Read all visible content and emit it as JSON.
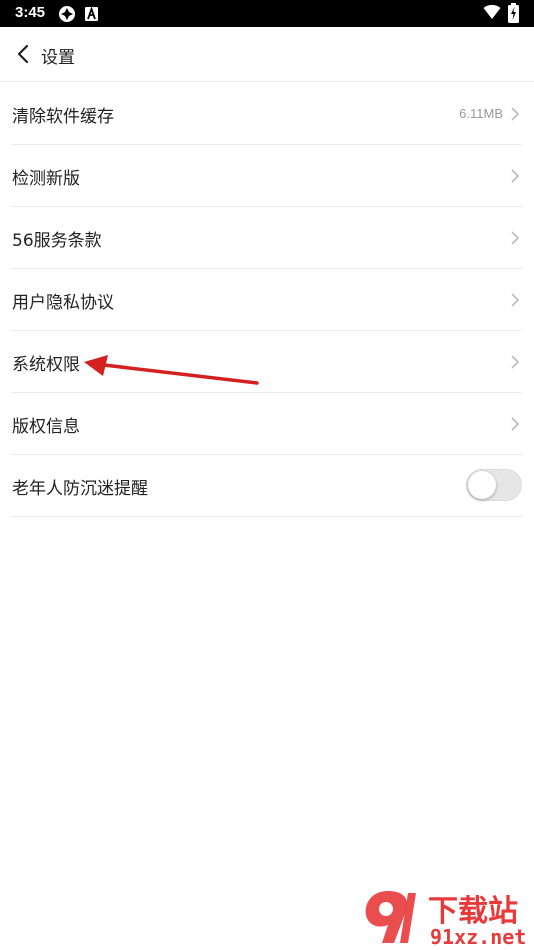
{
  "status_bar": {
    "time": "3:45",
    "icons": [
      "app-notification-icon",
      "a-letter-icon",
      "wifi-icon",
      "battery-charging-icon"
    ]
  },
  "header": {
    "back_icon": "chevron-left-icon",
    "title": "设置"
  },
  "settings": [
    {
      "label": "清除软件缓存",
      "value": "6.11MB",
      "control": "chevron"
    },
    {
      "label": "检测新版",
      "value": "",
      "control": "chevron"
    },
    {
      "label": "56服务条款",
      "value": "",
      "control": "chevron"
    },
    {
      "label": "用户隐私协议",
      "value": "",
      "control": "chevron"
    },
    {
      "label": "系统权限",
      "value": "",
      "control": "chevron"
    },
    {
      "label": "版权信息",
      "value": "",
      "control": "chevron"
    },
    {
      "label": "老年人防沉迷提醒",
      "control": "toggle",
      "toggle_on": false
    }
  ],
  "colors": {
    "annotation_arrow": "#d42020",
    "watermark": "#e83a3a"
  },
  "watermark": {
    "line1": "下载站",
    "line2": "91xz.net"
  }
}
